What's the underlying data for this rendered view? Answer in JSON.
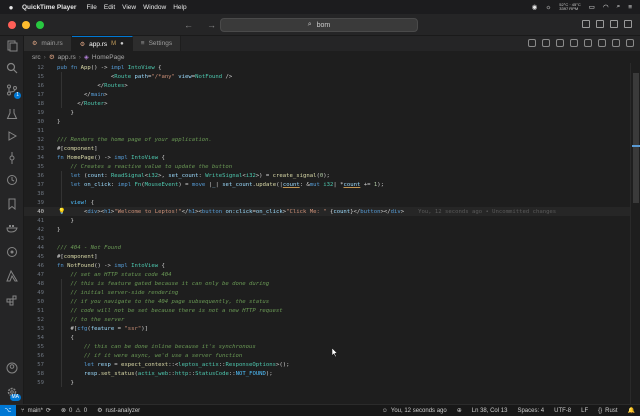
{
  "menubar": {
    "app_name": "QuickTime Player",
    "items": [
      "File",
      "Edit",
      "View",
      "Window",
      "Help"
    ],
    "stats_top": "52°C · 45°C",
    "stats_bottom": "3397 RPM"
  },
  "titlebar": {
    "search_text": "bom"
  },
  "tabs": [
    {
      "label": "main.rs",
      "modified": false,
      "active": false
    },
    {
      "label": "app.rs",
      "modified": true,
      "mod_marker": "M",
      "active": true
    },
    {
      "label": "Settings",
      "active": false
    }
  ],
  "breadcrumb": [
    "src",
    "app.rs",
    "HomePage"
  ],
  "activity_badge": "1",
  "account_badge": "MA",
  "editor": {
    "current_line": 38,
    "blame": "You, 12 seconds ago • Uncommitted changes"
  },
  "lines": [
    {
      "n": "12",
      "code": "pub fn App() -> impl IntoView {"
    },
    {
      "n": "15",
      "code": "                <Route path=\"/*any\" view=NotFound />"
    },
    {
      "n": "16",
      "code": "            </Routes>"
    },
    {
      "n": "17",
      "code": "        </main>"
    },
    {
      "n": "18",
      "code": "      </Router>"
    },
    {
      "n": "19",
      "code": "    }"
    },
    {
      "n": "30",
      "code": "}"
    },
    {
      "n": "31",
      "code": ""
    },
    {
      "n": "32",
      "code": "/// Renders the home page of your application."
    },
    {
      "n": "33",
      "code": "#[component]"
    },
    {
      "n": "34",
      "code": "fn HomePage() -> impl IntoView {"
    },
    {
      "n": "35",
      "code": "    // Creates a reactive value to update the button"
    },
    {
      "n": "36",
      "code": "    let (count: ReadSignal<i32>, set_count: WriteSignal<i32>) = create_signal(0);"
    },
    {
      "n": "37",
      "code": "    let on_click: impl Fn(MouseEvent) = move |_| set_count.update(|count: &mut i32| *count += 1);"
    },
    {
      "n": "38",
      "code": ""
    },
    {
      "n": "39",
      "code": "    view! {"
    },
    {
      "n": "40",
      "code": "        <div><h1>\"Welcome to Leptos!\"</h1><button on:click=on_click>\"Click Me: \" {count}</button></div>"
    },
    {
      "n": "41",
      "code": "    }"
    },
    {
      "n": "42",
      "code": "}"
    },
    {
      "n": "43",
      "code": ""
    },
    {
      "n": "44",
      "code": "/// 404 - Not Found"
    },
    {
      "n": "45",
      "code": "#[component]"
    },
    {
      "n": "46",
      "code": "fn NotFound() -> impl IntoView {"
    },
    {
      "n": "47",
      "code": "    // set an HTTP status code 404"
    },
    {
      "n": "48",
      "code": "    // this is feature gated because it can only be done during"
    },
    {
      "n": "49",
      "code": "    // initial server-side rendering"
    },
    {
      "n": "50",
      "code": "    // if you navigate to the 404 page subsequently, the status"
    },
    {
      "n": "51",
      "code": "    // code will not be set because there is not a new HTTP request"
    },
    {
      "n": "52",
      "code": "    // to the server"
    },
    {
      "n": "53",
      "code": "    #[cfg(feature = \"ssr\")]"
    },
    {
      "n": "54",
      "code": "    {"
    },
    {
      "n": "55",
      "code": "        // this can be done inline because it's synchronous"
    },
    {
      "n": "56",
      "code": "        // if it were async, we'd use a server function"
    },
    {
      "n": "57",
      "code": "        let resp = expect_context::<leptos_actix::ResponseOptions>();"
    },
    {
      "n": "58",
      "code": "        resp.set_status(actix_web::http::StatusCode::NOT_FOUND);"
    },
    {
      "n": "59",
      "code": "    }"
    }
  ],
  "statusbar": {
    "branch": "main*",
    "sync": "⟳",
    "errors": "0",
    "warnings": "0",
    "analyzer": "rust-analyzer",
    "blame_short": "You, 12 seconds ago",
    "position": "Ln 38, Col 13",
    "spaces": "Spaces: 4",
    "encoding": "UTF-8",
    "eol": "LF",
    "language": "Rust"
  }
}
